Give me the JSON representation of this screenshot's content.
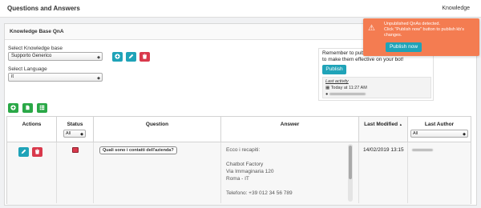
{
  "topbar": {
    "title": "Questions and Answers",
    "kb_link": "Knowledge"
  },
  "panel": {
    "title": "Knowledge Base QnA"
  },
  "kb_select": {
    "label": "Select Knowledge base",
    "value": "Supporto Generico"
  },
  "lang_select": {
    "label": "Select Language",
    "value": "it"
  },
  "icons": {
    "add": "plus-icon",
    "edit": "pencil-icon",
    "delete": "trash-icon",
    "file": "file-icon",
    "spreadsheet": "table-icon",
    "warning": "warning-icon",
    "calendar": "calendar-icon",
    "user": "user-icon"
  },
  "publish": {
    "line1": "Remember to publ",
    "line2": "to make them effective on your bot!",
    "button": "Publish",
    "last_activity_label": "Last activity",
    "last_activity_time": "Today at 11:27 AM"
  },
  "toast": {
    "line1": "Unpublished QnAs detected.",
    "line2": "Click \"Publish now\" button to publish kb's",
    "line3": "changes.",
    "button": "Publish now"
  },
  "table": {
    "headers": {
      "actions": "Actions",
      "status": "Status",
      "question": "Question",
      "answer": "Answer",
      "last_modified": "Last Modified",
      "last_author": "Last Author"
    },
    "sort_indicator": "▲",
    "status_filter": "All",
    "author_filter": "All",
    "rows": [
      {
        "question": "Quali sono i contatti dell'azienda?",
        "answer": [
          "Ecco i recapiti:",
          "",
          "Chatbot Factory",
          "Via Immaginaria 120",
          "Roma - IT",
          "",
          "Telefono: +39 012 34 56 789"
        ],
        "last_modified": "14/02/2019 13:15"
      }
    ]
  },
  "colors": {
    "teal": "#1fa3b8",
    "red": "#d9394c",
    "green": "#2aa847",
    "toast": "#f47c51"
  }
}
